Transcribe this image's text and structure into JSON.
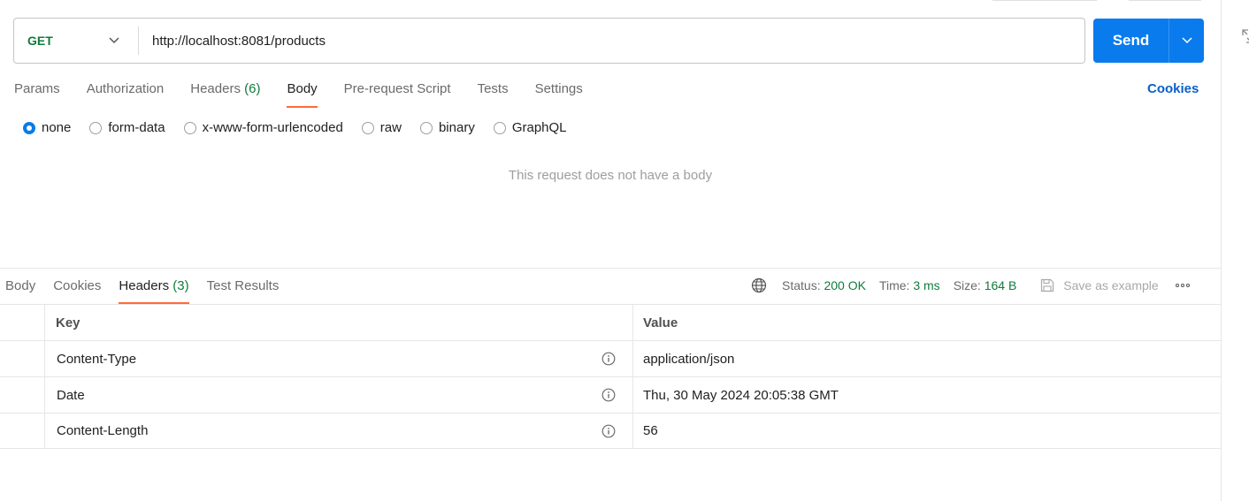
{
  "request": {
    "method": "GET",
    "url": "http://localhost:8081/products",
    "send_label": "Send"
  },
  "request_tabs": [
    {
      "label": "Params",
      "count": ""
    },
    {
      "label": "Authorization",
      "count": ""
    },
    {
      "label": "Headers",
      "count": "(6)"
    },
    {
      "label": "Body",
      "count": ""
    },
    {
      "label": "Pre-request Script",
      "count": ""
    },
    {
      "label": "Tests",
      "count": ""
    },
    {
      "label": "Settings",
      "count": ""
    }
  ],
  "cookies_link": "Cookies",
  "body_types": [
    "none",
    "form-data",
    "x-www-form-urlencoded",
    "raw",
    "binary",
    "GraphQL"
  ],
  "selected_body_type": "none",
  "no_body_message": "This request does not have a body",
  "response_tabs": [
    {
      "label": "Body",
      "count": ""
    },
    {
      "label": "Cookies",
      "count": ""
    },
    {
      "label": "Headers",
      "count": "(3)"
    },
    {
      "label": "Test Results",
      "count": ""
    }
  ],
  "response_meta": {
    "status_label": "Status:",
    "status_value": "200 OK",
    "time_label": "Time:",
    "time_value": "3 ms",
    "size_label": "Size:",
    "size_value": "164 B",
    "save_example": "Save as example"
  },
  "headers_table": {
    "columns": [
      "Key",
      "Value"
    ],
    "rows": [
      {
        "key": "Content-Type",
        "value": "application/json"
      },
      {
        "key": "Date",
        "value": "Thu, 30 May 2024 20:05:38 GMT"
      },
      {
        "key": "Content-Length",
        "value": "56"
      }
    ]
  },
  "colors": {
    "accent_blue": "#097bed",
    "tab_underline": "#ff6c37",
    "status_green": "#0f7b3b"
  }
}
